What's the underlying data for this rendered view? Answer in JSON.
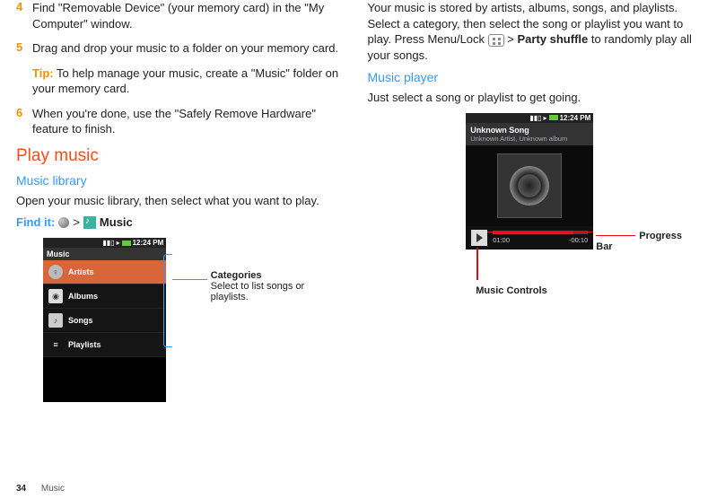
{
  "left": {
    "step4": {
      "num": "4",
      "text": "Find \"Removable Device\" (your memory card) in the \"My Computer\" window."
    },
    "step5": {
      "num": "5",
      "text": "Drag and drop your music to a folder on your memory card."
    },
    "tip": {
      "label": "Tip:",
      "text": " To help manage your music, create a \"Music\" folder on your memory card."
    },
    "step6": {
      "num": "6",
      "text": "When you're done, use the \"Safely Remove Hardware\" feature to finish."
    },
    "h2": "Play music",
    "h3": "Music library",
    "body": "Open your music library, then select what you want to play.",
    "find_label": "Find it:",
    "find_sep": ">",
    "find_app": "Music",
    "phone": {
      "time": "12:24 PM",
      "title": "Music",
      "items": [
        "Artists",
        "Albums",
        "Songs",
        "Playlists"
      ]
    },
    "callout": {
      "title": "Categories",
      "text": "Select to list songs or playlists."
    }
  },
  "right": {
    "para1a": "Your music is stored by artists, albums, songs, and playlists. Select a category, then select the song or playlist you want to play. Press Menu/Lock ",
    "para1b": " > ",
    "party": "Party shuffle",
    "para1c": " to randomly play all your songs.",
    "h3": "Music player",
    "body": "Just select a song or playlist to get going.",
    "phone": {
      "time": "12:24 PM",
      "song": "Unknown Song",
      "artist_album": "Unknown Artist, Unknown album",
      "elapsed": "01:00",
      "remaining": "-00:10"
    },
    "callout_progress": "Progress Bar",
    "callout_controls": "Music Controls"
  },
  "footer": {
    "page": "34",
    "section": "Music"
  }
}
